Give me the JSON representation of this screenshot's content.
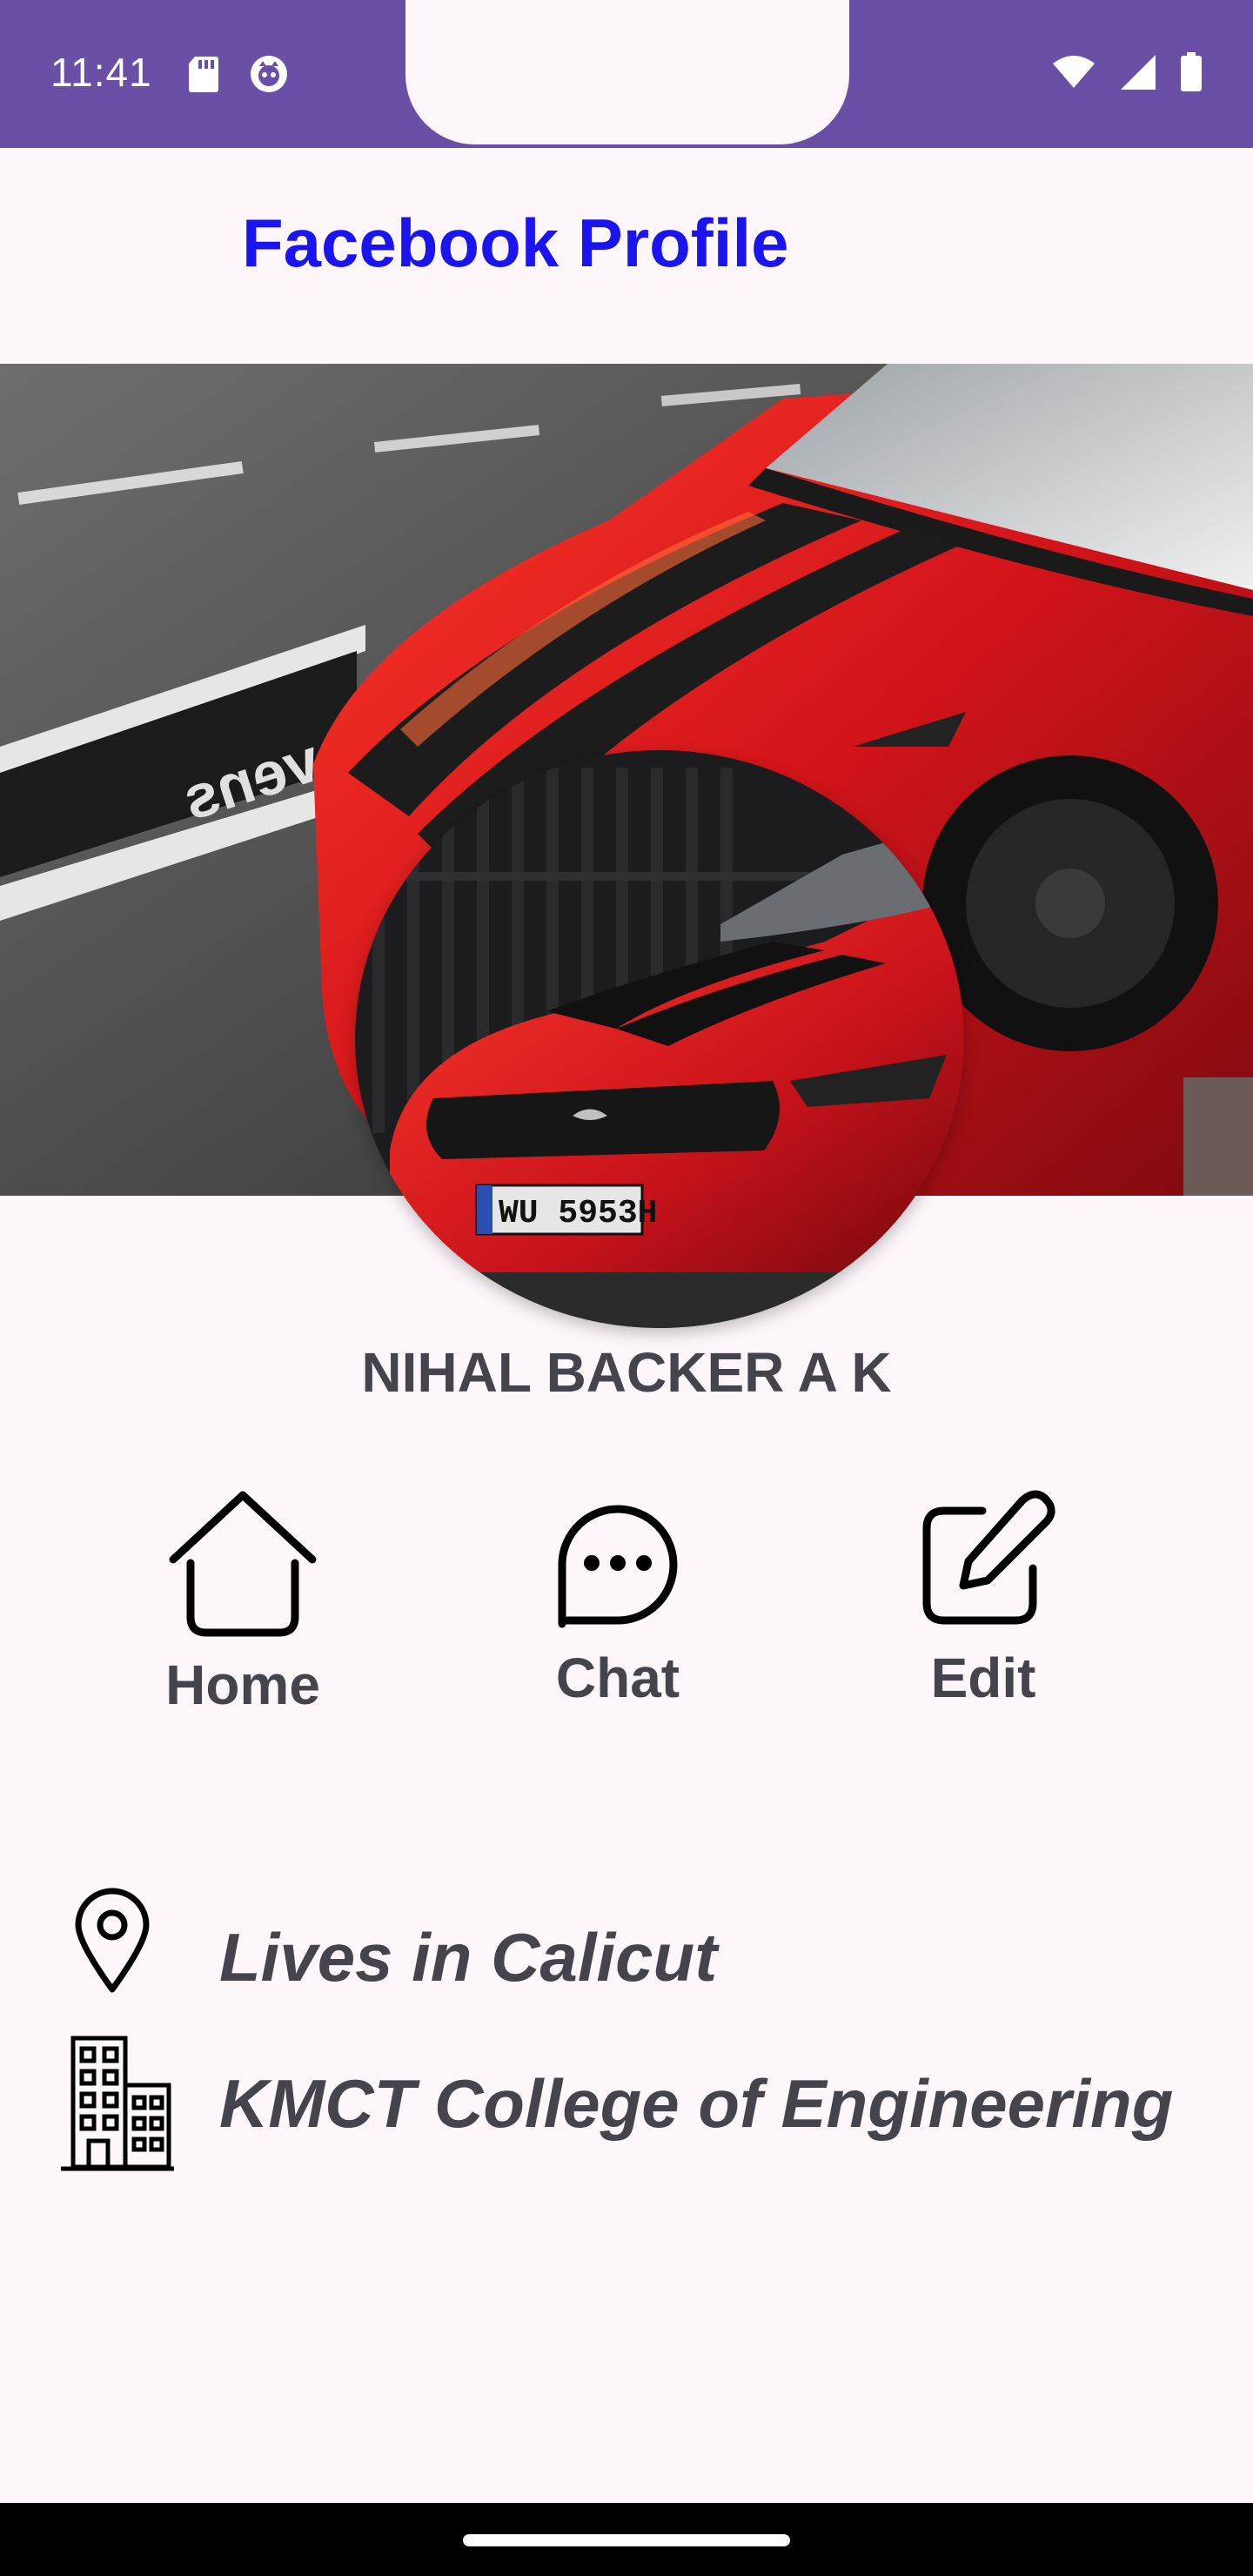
{
  "status_bar": {
    "time": "11:41",
    "background_color": "#6a4fa6",
    "left_icons": [
      "sd-card-icon",
      "app-notification-icon"
    ],
    "right_icons": [
      "wifi-icon",
      "cellular-signal-icon",
      "battery-icon"
    ]
  },
  "header": {
    "title": "Facebook Profile",
    "title_color": "#1a14f0"
  },
  "profile": {
    "cover_image": "red-mustang-cover-photo",
    "avatar_image": "red-mustang-front-avatar",
    "name": "NIHAL BACKER A K"
  },
  "actions": [
    {
      "label": "Home",
      "icon": "home-icon"
    },
    {
      "label": "Chat",
      "icon": "chat-bubble-icon"
    },
    {
      "label": "Edit",
      "icon": "edit-icon"
    }
  ],
  "info": [
    {
      "text": "Lives in Calicut",
      "icon": "location-pin-icon"
    },
    {
      "text": "KMCT College of Engineering",
      "icon": "building-icon"
    }
  ]
}
